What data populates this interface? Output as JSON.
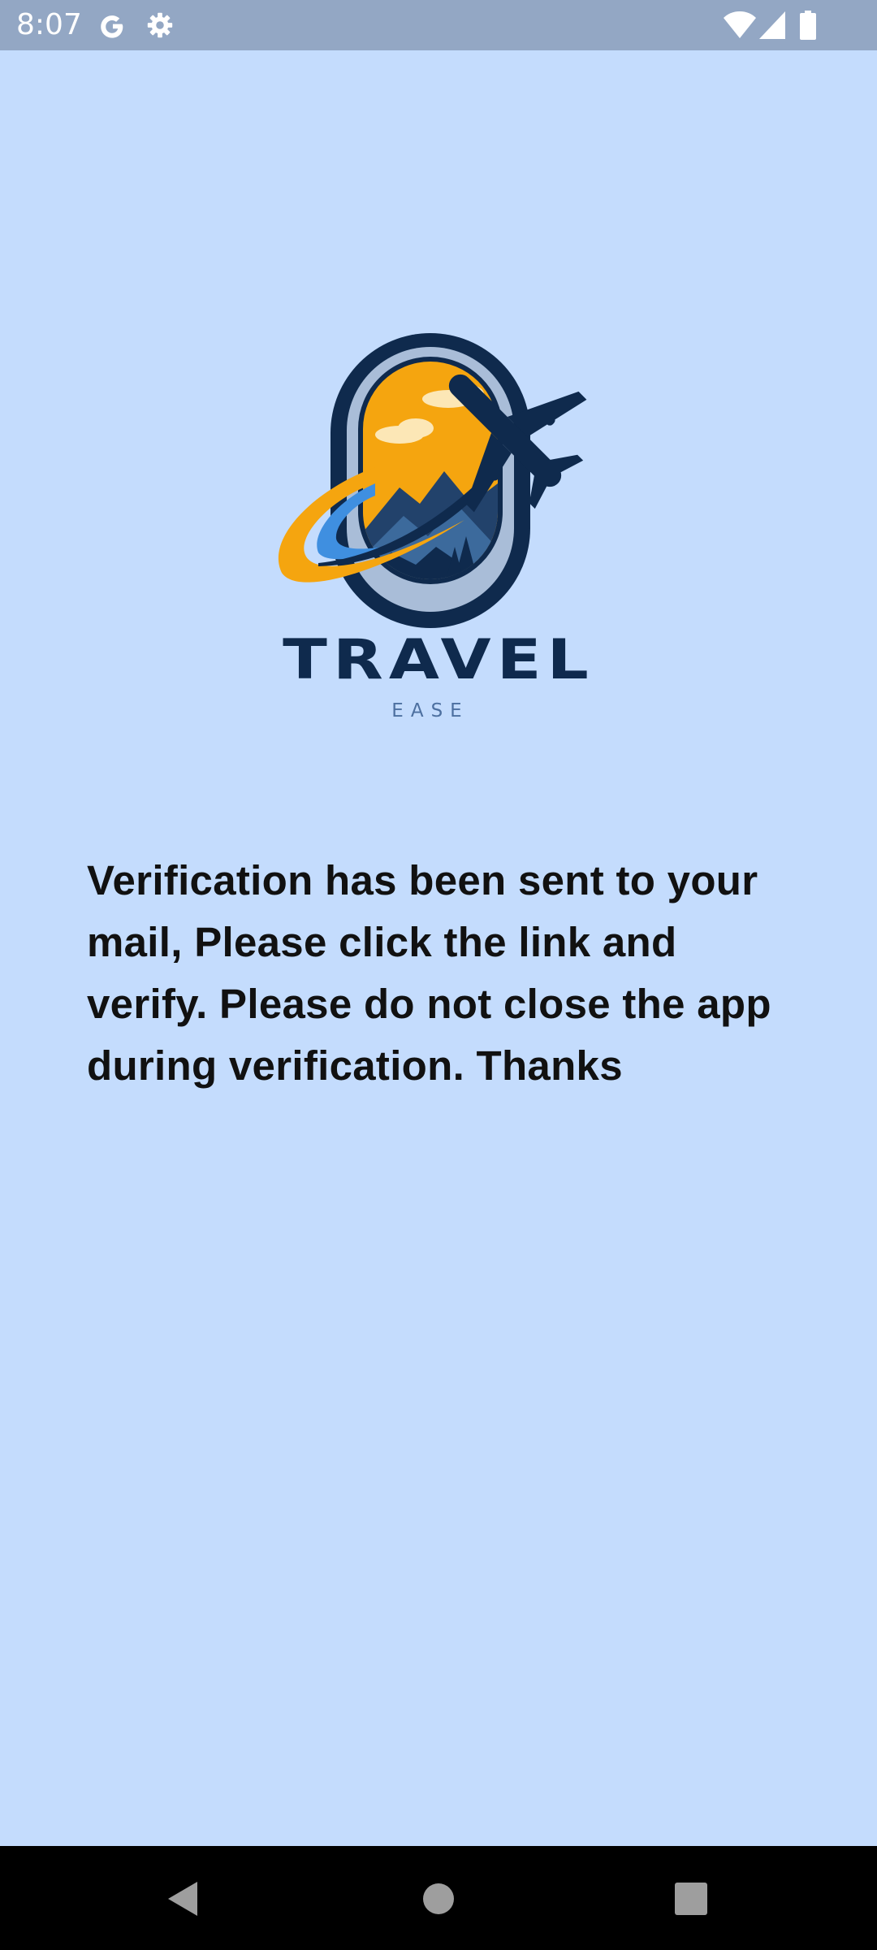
{
  "status_bar": {
    "time": "8:07",
    "left_icons": [
      "google-icon",
      "settings-icon"
    ],
    "right_icons": [
      "wifi-icon",
      "signal-icon",
      "battery-icon"
    ]
  },
  "logo": {
    "wordmark": "TRAVEL",
    "tagline": "EASE",
    "colors": {
      "navy": "#0f2a4d",
      "orange": "#f5a50f",
      "frame": "#a9bdd8",
      "blue": "#3f8fe0"
    }
  },
  "message": {
    "text": "Verification has been sent to your mail, Please click the link and verify. Please do not close the app during verification. Thanks"
  },
  "nav_bar": {
    "buttons": [
      "back-icon",
      "home-icon",
      "recents-icon"
    ]
  },
  "theme": {
    "background": "#c4dcfd",
    "status_bar": "#93a7c4",
    "nav_bar": "#000000",
    "text": "#111111"
  }
}
